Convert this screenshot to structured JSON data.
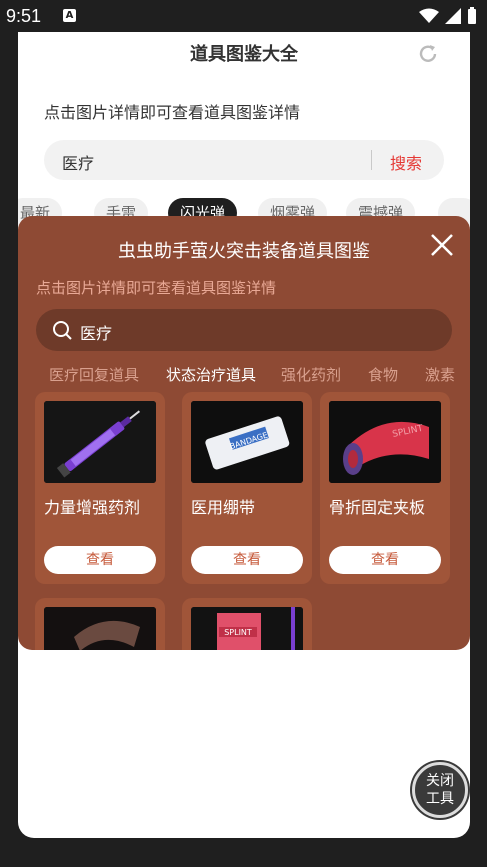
{
  "status": {
    "time": "9:51",
    "notif_icon": "A"
  },
  "app": {
    "title": "道具图鉴大全",
    "hint": "点击图片详情即可查看道具图鉴详情",
    "search_value": "医疗",
    "search_button": "搜索",
    "tags": [
      "最新",
      "手雷",
      "闪光弹",
      "烟雾弹",
      "震撼弹"
    ],
    "active_tag": "闪光弹"
  },
  "modal": {
    "title": "虫虫助手萤火突击装备道具图鉴",
    "hint": "点击图片详情即可查看道具图鉴详情",
    "search_value": "医疗",
    "categories": [
      "医疗回复道具",
      "状态治疗道具",
      "强化药剂",
      "食物",
      "激素"
    ],
    "active_category": "状态治疗道具",
    "items": [
      {
        "name": "力量增强药剂",
        "view": "查看"
      },
      {
        "name": "医用绷带",
        "view": "查看"
      },
      {
        "name": "骨折固定夹板",
        "view": "查看"
      },
      {
        "name": "",
        "view": ""
      },
      {
        "name": "",
        "view": ""
      }
    ],
    "bandage_label": "BANDAGE",
    "splint_label": "SPLINT"
  },
  "tool": {
    "line1": "关闭",
    "line2": "工具"
  },
  "colors": {
    "modal_bg": "#8e4a34",
    "accent_red": "#e53935",
    "card_bg": "#a05539"
  }
}
